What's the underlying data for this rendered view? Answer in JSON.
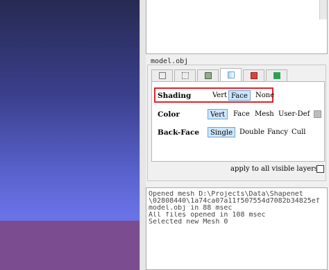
{
  "model_label": "model.obj",
  "tabs": [
    {
      "icon": "box-wireframe-icon"
    },
    {
      "icon": "dotted-box-icon"
    },
    {
      "icon": "texture-icon"
    },
    {
      "icon": "shading-icon",
      "active": true
    },
    {
      "icon": "color-icon"
    },
    {
      "icon": "green-settings-icon"
    }
  ],
  "shading": {
    "label": "Shading",
    "options": [
      "Vert",
      "Face",
      "None"
    ],
    "selected": "Face"
  },
  "color": {
    "label": "Color",
    "options": [
      "Vert",
      "Face",
      "Mesh",
      "User-Def"
    ],
    "selected": "Vert",
    "swatch": "#bdbdbd"
  },
  "backface": {
    "label": "Back-Face",
    "options": [
      "Single",
      "Double",
      "Fancy",
      "Cull"
    ],
    "selected": "Single"
  },
  "apply_label": "apply to all visible layers",
  "log_lines": [
    "Opened mesh D:\\Projects\\Data\\Shapenet",
    "\\02808440\\1a74ca07a11f507554d7082b34825ef",
    "model.obj in 88 msec",
    "All files opened in 108 msec",
    "Selected new Mesh 0"
  ],
  "colors": {
    "highlight": "#e0232b",
    "selected_bg": "#cde6fb",
    "viewport_top": "#272a52",
    "floor": "#7b4c8f"
  }
}
